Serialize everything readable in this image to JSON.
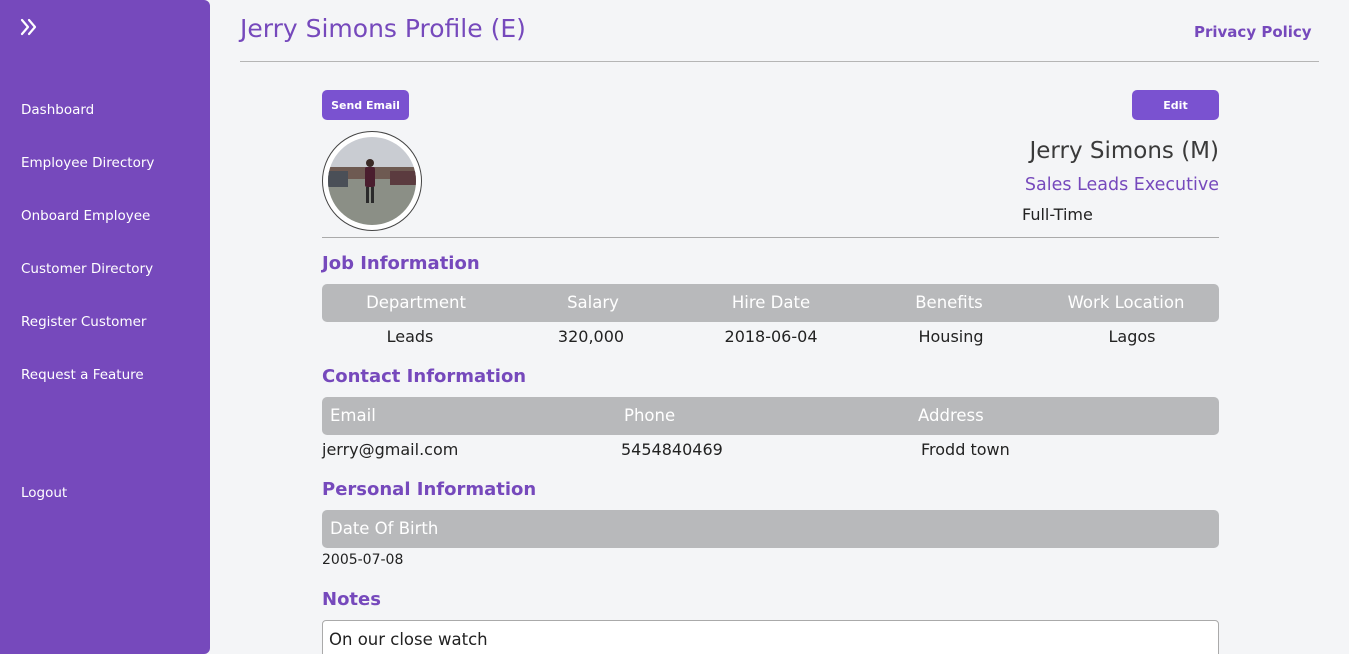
{
  "sidebar": {
    "toggle_icon": "double-chevron-right-icon",
    "items": [
      {
        "label": "Dashboard"
      },
      {
        "label": "Employee Directory"
      },
      {
        "label": "Onboard Employee"
      },
      {
        "label": "Customer Directory"
      },
      {
        "label": "Register Customer"
      },
      {
        "label": "Request a Feature"
      }
    ],
    "logout_label": "Logout"
  },
  "header": {
    "title": "Jerry Simons Profile (E)",
    "privacy_link": "Privacy Policy"
  },
  "actions": {
    "send_email_label": "Send Email",
    "edit_label": "Edit"
  },
  "profile": {
    "name": "Jerry Simons (M)",
    "role": "Sales Leads Executive",
    "employment_type": "Full-Time"
  },
  "job_information": {
    "heading": "Job Information",
    "headers": [
      "Department",
      "Salary",
      "Hire Date",
      "Benefits",
      "Work Location"
    ],
    "values": [
      "Leads",
      "320,000",
      "2018-06-04",
      "Housing",
      "Lagos"
    ]
  },
  "contact_information": {
    "heading": "Contact Information",
    "headers": [
      "Email",
      "Phone",
      "Address"
    ],
    "values": [
      "jerry@gmail.com",
      "5454840469",
      "Frodd town"
    ]
  },
  "personal_information": {
    "heading": "Personal Information",
    "headers": [
      "Date Of Birth"
    ],
    "values": [
      "2005-07-08"
    ]
  },
  "notes": {
    "heading": "Notes",
    "text": "On our close watch"
  },
  "colors": {
    "brand_purple": "#7649bc",
    "button_purple": "#7a52d0",
    "table_header_gray": "#b8b9bb",
    "page_background": "#f4f5f7"
  }
}
